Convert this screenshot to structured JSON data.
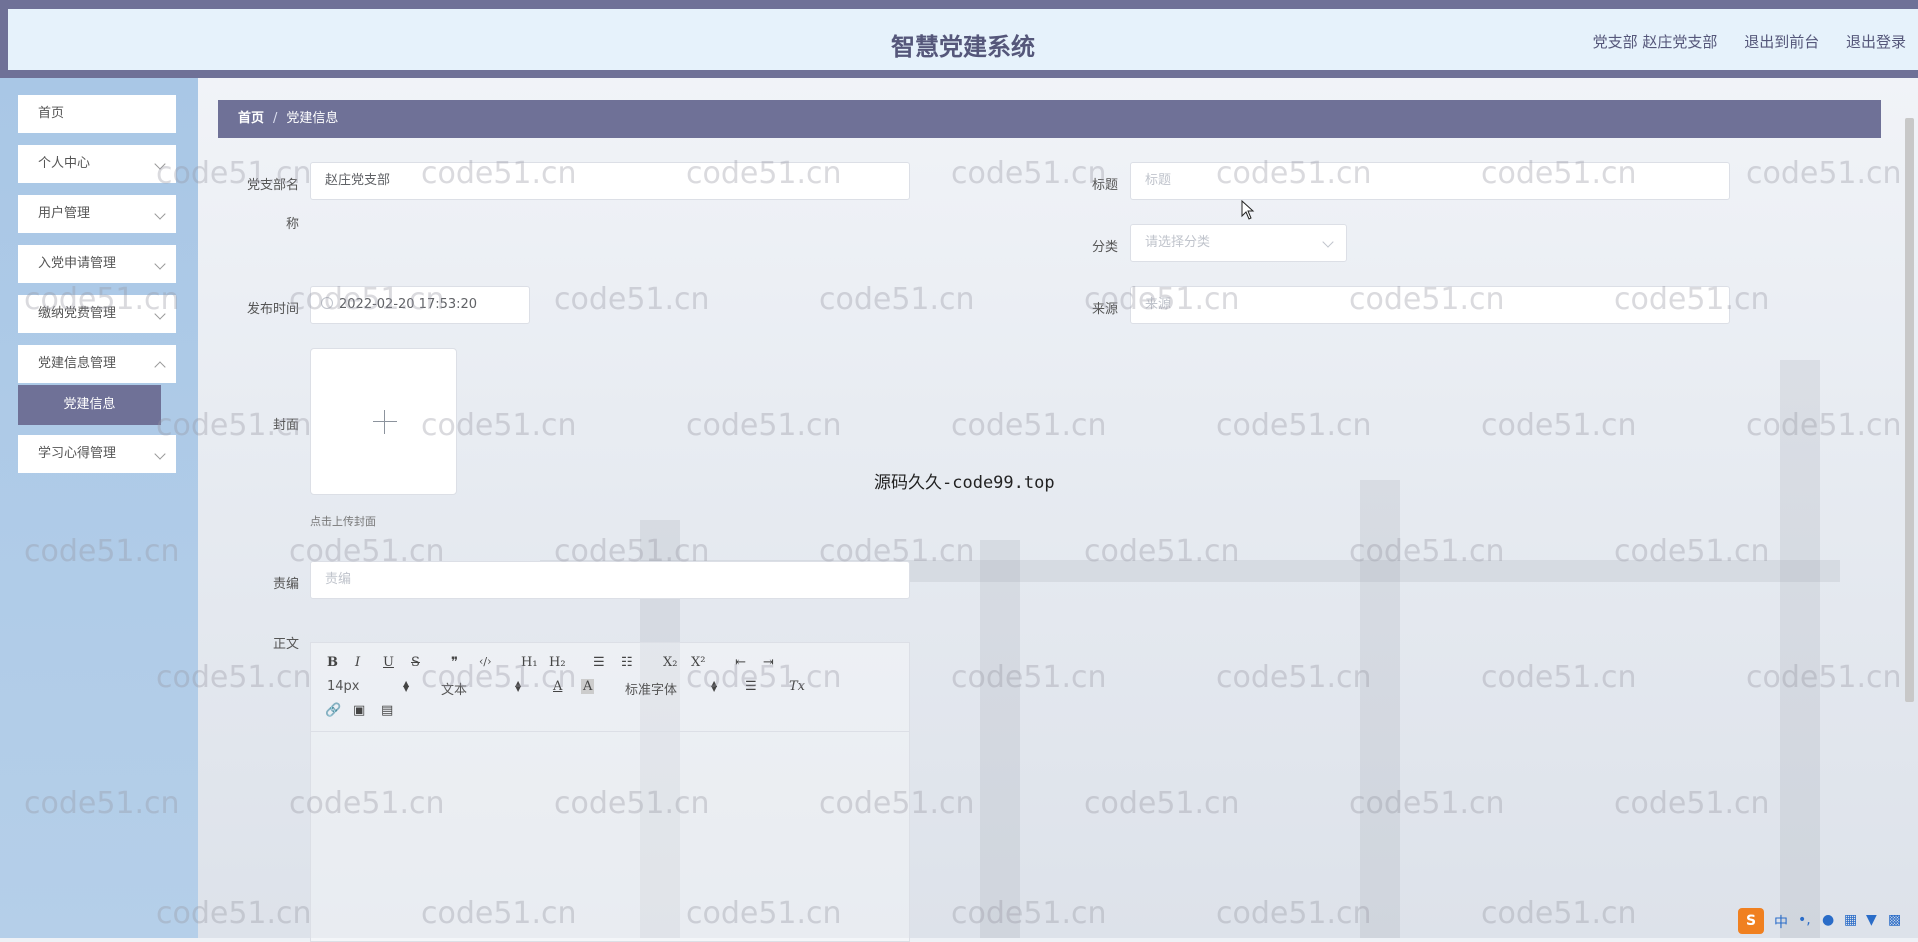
{
  "header": {
    "title": "智慧党建系统",
    "user_label": "党支部 赵庄党支部",
    "to_frontend": "退出到前台",
    "logout": "退出登录"
  },
  "watermark": {
    "text": "code51.cn",
    "center_text": "源码久久-code99.top"
  },
  "sidebar": {
    "items": [
      {
        "label": "首页"
      },
      {
        "label": "个人中心"
      },
      {
        "label": "用户管理"
      },
      {
        "label": "入党申请管理"
      },
      {
        "label": "缴纳党费管理"
      },
      {
        "label": "党建信息管理"
      },
      {
        "label": "学习心得管理"
      }
    ],
    "active_sub": "党建信息"
  },
  "breadcrumb": {
    "home": "首页",
    "separator": "/",
    "current": "党建信息"
  },
  "form": {
    "branch_name_label_1": "党支部名",
    "branch_name_label_2": "称",
    "branch_name_value": "赵庄党支部",
    "title_label": "标题",
    "title_placeholder": "标题",
    "category_label": "分类",
    "category_placeholder": "请选择分类",
    "publish_time_label": "发布时间",
    "publish_time_value": "2022-02-20 17:53:20",
    "source_label": "来源",
    "source_placeholder": "来源",
    "cover_label": "封面",
    "cover_tip": "点击上传封面",
    "editor_label": "责编",
    "editor_placeholder": "责编",
    "body_label": "正文"
  },
  "editor_toolbar": {
    "bold": "B",
    "italic": "I",
    "underline": "U",
    "strike": "S",
    "quote": "❞",
    "code": "‹/›",
    "h1": "H₁",
    "h2": "H₂",
    "ordered_list": "☰",
    "bullet_list": "☷",
    "subscript": "X₂",
    "superscript": "X²",
    "outdent": "⇤",
    "indent": "⇥",
    "font_size": "14px",
    "text_style": "文本",
    "font_family": "标准字体",
    "clean": "Tx"
  },
  "ime": {
    "logo": "S",
    "lang": "中"
  }
}
